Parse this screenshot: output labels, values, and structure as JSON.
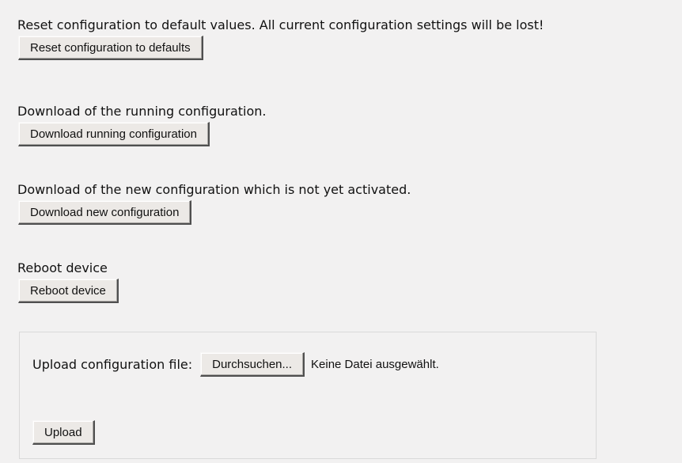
{
  "reset": {
    "description": "Reset configuration to default values. All current configuration settings will be lost!",
    "button_label": "Reset configuration to defaults"
  },
  "running": {
    "description": "Download of the running configuration.",
    "button_label": "Download running configuration"
  },
  "new_config": {
    "description": "Download of the new configuration which is not yet activated.",
    "button_label": "Download new configuration"
  },
  "reboot": {
    "description": "Reboot device",
    "button_label": "Reboot device"
  },
  "upload": {
    "label": "Upload configuration file:",
    "browse_label": "Durchsuchen...",
    "file_status": "Keine Datei ausgewählt.",
    "upload_label": "Upload"
  }
}
